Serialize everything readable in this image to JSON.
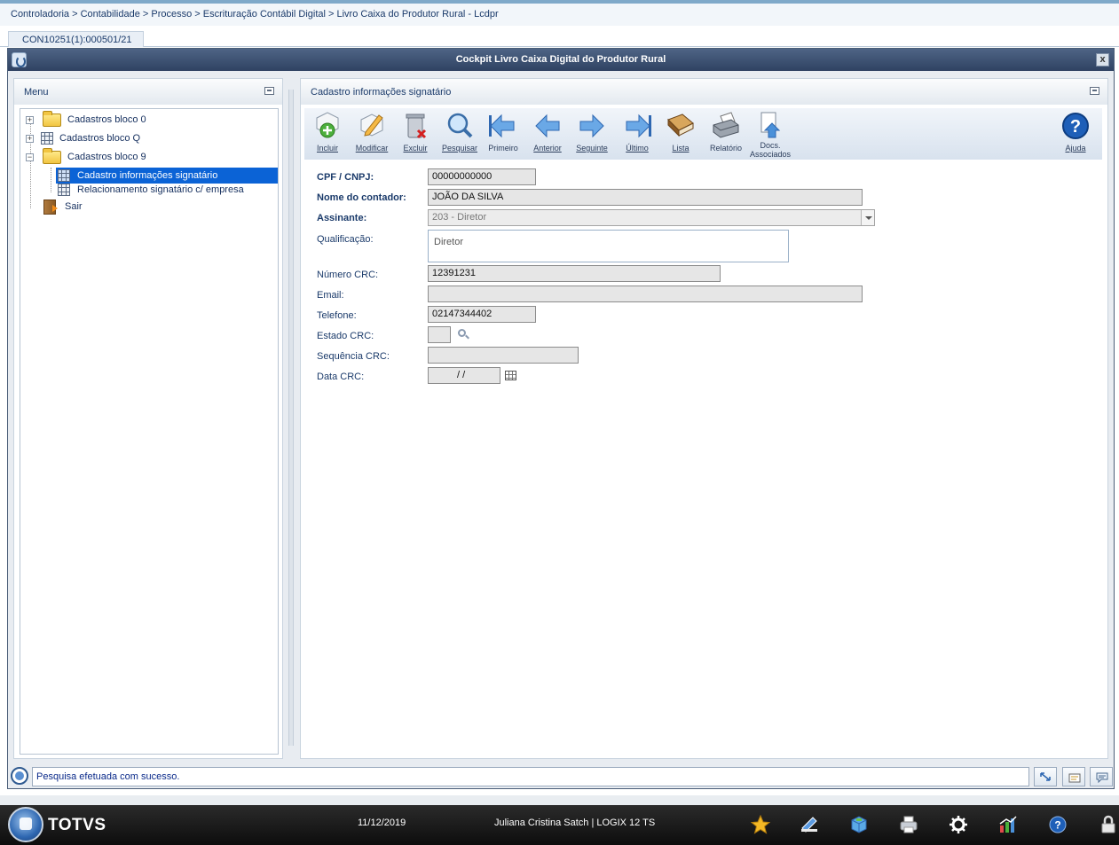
{
  "breadcrumb": "Controladoria > Contabilidade > Processo > Escrituração Contábil Digital > Livro Caixa do Produtor Rural - Lcdpr",
  "tab": {
    "label": "CON10251(1):000501/21"
  },
  "window": {
    "title": "Cockpit Livro Caixa Digital do Produtor Rural",
    "close": "x"
  },
  "menu": {
    "title": "Menu",
    "items": [
      {
        "label": "Cadastros bloco 0",
        "expander": "+"
      },
      {
        "label": "Cadastros bloco Q",
        "expander": "+"
      },
      {
        "label": "Cadastros bloco 9",
        "expander": "−"
      },
      {
        "label": "Cadastro informações signatário"
      },
      {
        "label": "Relacionamento signatário c/ empresa"
      },
      {
        "label": "Sair"
      }
    ]
  },
  "panel": {
    "title": "Cadastro informações signatário"
  },
  "toolbar": {
    "incluir": "Incluir",
    "modificar": "Modificar",
    "excluir": "Excluir",
    "pesquisar": "Pesquisar",
    "primeiro": "Primeiro",
    "anterior": "Anterior",
    "seguinte": "Seguinte",
    "ultimo": "Último",
    "lista": "Lista",
    "relatorio": "Relatório",
    "docs_line1": "Docs.",
    "docs_line2": "Associados",
    "ajuda": "Ajuda"
  },
  "form": {
    "cpf_label": "CPF / CNPJ:",
    "cpf_value": "00000000000",
    "contador_label": "Nome do contador:",
    "contador_value": "JOÃO DA SILVA",
    "assinante_label": "Assinante:",
    "assinante_value": "203 - Diretor",
    "qualificacao_label": "Qualificação:",
    "qualificacao_value": "Diretor",
    "crc_label": "Número CRC:",
    "crc_value": "12391231",
    "email_label": "Email:",
    "email_value": "",
    "telefone_label": "Telefone:",
    "telefone_value": "02147344402",
    "estado_label": "Estado CRC:",
    "estado_value": "",
    "sequencia_label": "Sequência CRC:",
    "sequencia_value": "",
    "data_label": "Data CRC:",
    "data_value": "/ /"
  },
  "status": {
    "message": "Pesquisa efetuada com sucesso."
  },
  "footer": {
    "brand": "TOTVS",
    "date": "11/12/2019",
    "user": "Juliana Cristina Satch | LOGIX 12 TS"
  },
  "colors": {
    "titlebar": "#3b5072",
    "selection": "#0b63d6",
    "footer": "#111111",
    "accent": "#2e67b1"
  }
}
